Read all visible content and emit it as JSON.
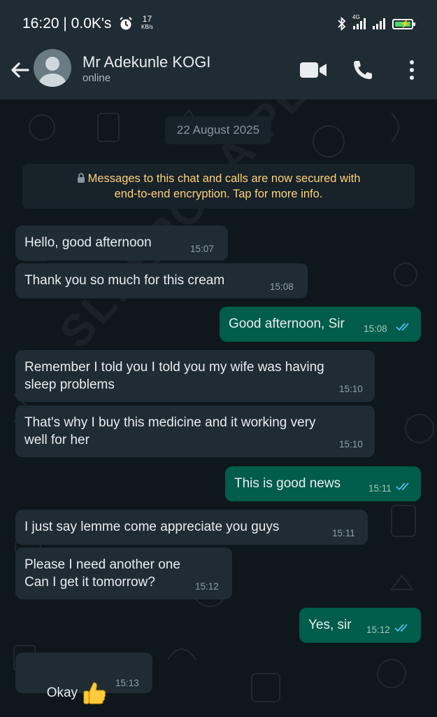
{
  "status_bar": {
    "time_and_speed": "16:20 | 0.0K's",
    "net_rate": "17",
    "net_unit": "KB/s",
    "network_type": "4G",
    "icons": [
      "alarm-icon",
      "bluetooth-icon",
      "signal-icon",
      "battery-charging-icon"
    ]
  },
  "header": {
    "contact_name": "Mr Adekunle KOGI",
    "contact_status": "online",
    "icons": [
      "back-arrow-icon",
      "avatar",
      "video-call-icon",
      "voice-call-icon",
      "more-options-icon"
    ]
  },
  "chat": {
    "watermark": "SLEEPORA PLUS",
    "date_chip": "22 August 2025",
    "encryption_notice_line1": "Messages to this chat and calls are now secured with",
    "encryption_notice_line2": "end-to-end encryption. Tap for more info.",
    "messages": [
      {
        "direction": "in",
        "text": "Hello, good afternoon",
        "time": "15:07"
      },
      {
        "direction": "in",
        "text": "Thank you so much for this cream",
        "time": "15:08"
      },
      {
        "direction": "out",
        "text": "Good afternoon, Sir",
        "time": "15:08",
        "status": "read"
      },
      {
        "direction": "in",
        "text": "Remember I told you I told you my wife was having\nsleep problems",
        "time": "15:10"
      },
      {
        "direction": "in",
        "text": "That's why I buy this medicine and it working very\nwell for her",
        "time": "15:10"
      },
      {
        "direction": "out",
        "text": "This is good news",
        "time": "15:11",
        "status": "read"
      },
      {
        "direction": "in",
        "text": "I just say lemme come appreciate you guys",
        "time": "15:11"
      },
      {
        "direction": "in",
        "text": "Please I need another one\nCan I get it tomorrow?",
        "time": "15:12"
      },
      {
        "direction": "out",
        "text": "Yes, sir",
        "time": "15:12",
        "status": "read"
      },
      {
        "direction": "in",
        "text": "Okay",
        "time": "15:13",
        "emoji": "thumbs-up-icon"
      }
    ]
  },
  "colors": {
    "header_bg": "#1f2c34",
    "chat_bg": "#0d171c",
    "incoming_bubble": "#1f2c34",
    "outgoing_bubble": "#005c4b",
    "encryption_text": "#ffd279",
    "read_ticks": "#53bdeb"
  }
}
